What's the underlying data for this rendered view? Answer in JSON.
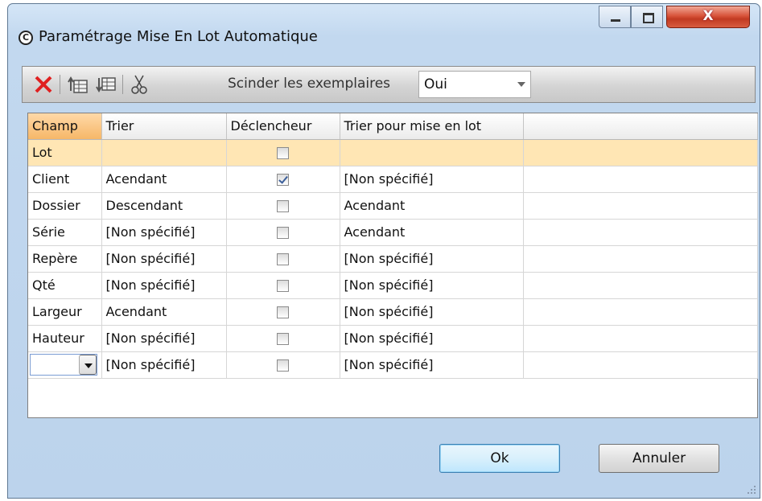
{
  "window": {
    "title": "Paramétrage Mise En Lot Automatique",
    "app_icon_glyph": "C",
    "close_glyph": "X"
  },
  "toolbar": {
    "delete_icon": "delete-icon",
    "insert_above_icon": "insert-row-above-icon",
    "insert_below_icon": "insert-row-below-icon",
    "cut_icon": "cut-icon",
    "split_label": "Scinder les exemplaires",
    "split_value": "Oui"
  },
  "grid": {
    "columns": [
      "Champ",
      "Trier",
      "Déclencheur",
      "Trier pour mise en lot",
      ""
    ],
    "rows": [
      {
        "champ": "Lot",
        "trier": "",
        "declencheur": false,
        "trier_lot": "",
        "selected": true
      },
      {
        "champ": "Client",
        "trier": "Acendant",
        "declencheur": true,
        "trier_lot": "[Non spécifié]"
      },
      {
        "champ": "Dossier",
        "trier": "Descendant",
        "declencheur": false,
        "trier_lot": "Acendant"
      },
      {
        "champ": "Série",
        "trier": "[Non spécifié]",
        "declencheur": false,
        "trier_lot": "Acendant"
      },
      {
        "champ": "Repère",
        "trier": "[Non spécifié]",
        "declencheur": false,
        "trier_lot": "[Non spécifié]"
      },
      {
        "champ": "Qté",
        "trier": "[Non spécifié]",
        "declencheur": false,
        "trier_lot": "[Non spécifié]"
      },
      {
        "champ": "Largeur",
        "trier": "Acendant",
        "declencheur": false,
        "trier_lot": "[Non spécifié]"
      },
      {
        "champ": "Hauteur",
        "trier": "[Non spécifié]",
        "declencheur": false,
        "trier_lot": "[Non spécifié]"
      },
      {
        "champ": "",
        "trier": "[Non spécifié]",
        "declencheur": false,
        "trier_lot": "[Non spécifié]",
        "new_row": true
      }
    ]
  },
  "buttons": {
    "ok": "Ok",
    "cancel": "Annuler"
  },
  "colors": {
    "selected_row": "#ffe6b4",
    "selected_header": "#f6b768",
    "delete_icon": "#e02020"
  }
}
